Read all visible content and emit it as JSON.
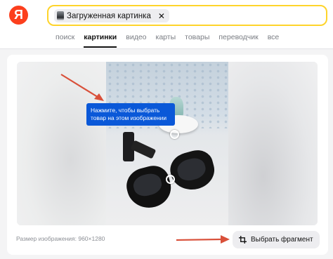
{
  "header": {
    "logo_letter": "Я",
    "search": {
      "chip_label": "Загруженная картинка",
      "chip_close": "✕"
    },
    "tabs": [
      {
        "label": "поиск",
        "active": false
      },
      {
        "label": "картинки",
        "active": true
      },
      {
        "label": "видео",
        "active": false
      },
      {
        "label": "карты",
        "active": false
      },
      {
        "label": "товары",
        "active": false
      },
      {
        "label": "переводчик",
        "active": false
      },
      {
        "label": "все",
        "active": false
      }
    ]
  },
  "viewer": {
    "tooltip_text": "Нажмите, чтобы выбрать товар на этом изображении",
    "size_label": "Размер изображения: 960×1280",
    "select_fragment_label": "Выбрать фрагмент"
  },
  "colors": {
    "brand_red": "#fc3f1d",
    "search_border": "#fed42b",
    "tooltip_blue": "#0a58d8",
    "annotation_arrow": "#d9503a"
  }
}
